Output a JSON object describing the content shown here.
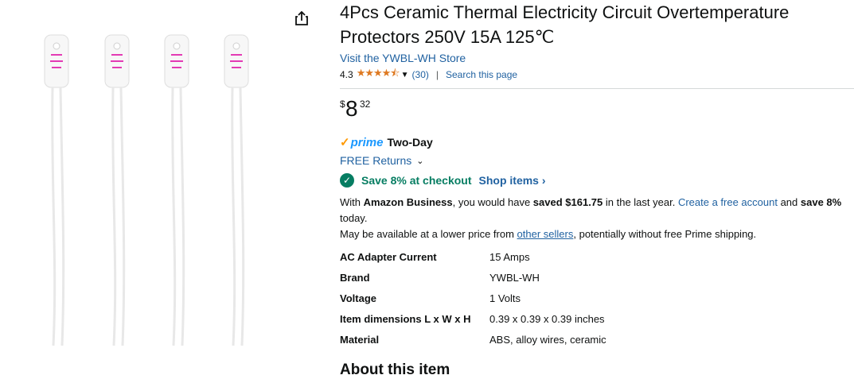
{
  "product": {
    "title": "4Pcs Ceramic Thermal Electricity Circuit Overtemperature Protectors 250V 15A 125℃",
    "store_link": "Visit the YWBL-WH Store",
    "rating": "4.3",
    "review_count": "(30)",
    "search_page": "Search this page"
  },
  "price": {
    "symbol": "$",
    "whole": "8",
    "fraction": "32"
  },
  "delivery": {
    "prime_word": "prime",
    "prime_label": "Two-Day",
    "returns": "FREE Returns"
  },
  "savings": {
    "text": "Save 8% at checkout",
    "shop_items": "Shop items"
  },
  "business": {
    "prefix": "With ",
    "brand": "Amazon Business",
    "middle": ", you would have ",
    "saved": "saved $161.75",
    "after": " in the last year. ",
    "create_link": "Create a free account",
    "and": " and ",
    "save_bold": "save 8%",
    "today": " today.",
    "lower_prefix": "May be available at a lower price from ",
    "other_sellers": "other sellers",
    "lower_suffix": ", potentially without free Prime shipping."
  },
  "specs": [
    {
      "key": "AC Adapter Current",
      "value": "15 Amps"
    },
    {
      "key": "Brand",
      "value": "YWBL-WH"
    },
    {
      "key": "Voltage",
      "value": "1 Volts"
    },
    {
      "key": "Item dimensions L x W x H",
      "value": "0.39 x 0.39 x 0.39 inches"
    },
    {
      "key": "Material",
      "value": "ABS, alloy wires, ceramic"
    }
  ],
  "about_heading": "About this item",
  "icons": {
    "share": "share-icon",
    "stars": "star-rating-icon",
    "check": "checkmark-circle-icon"
  },
  "colors": {
    "link": "#2162a1",
    "green": "#067d62",
    "star": "#de7921",
    "prime_blue": "#1a98ff"
  }
}
